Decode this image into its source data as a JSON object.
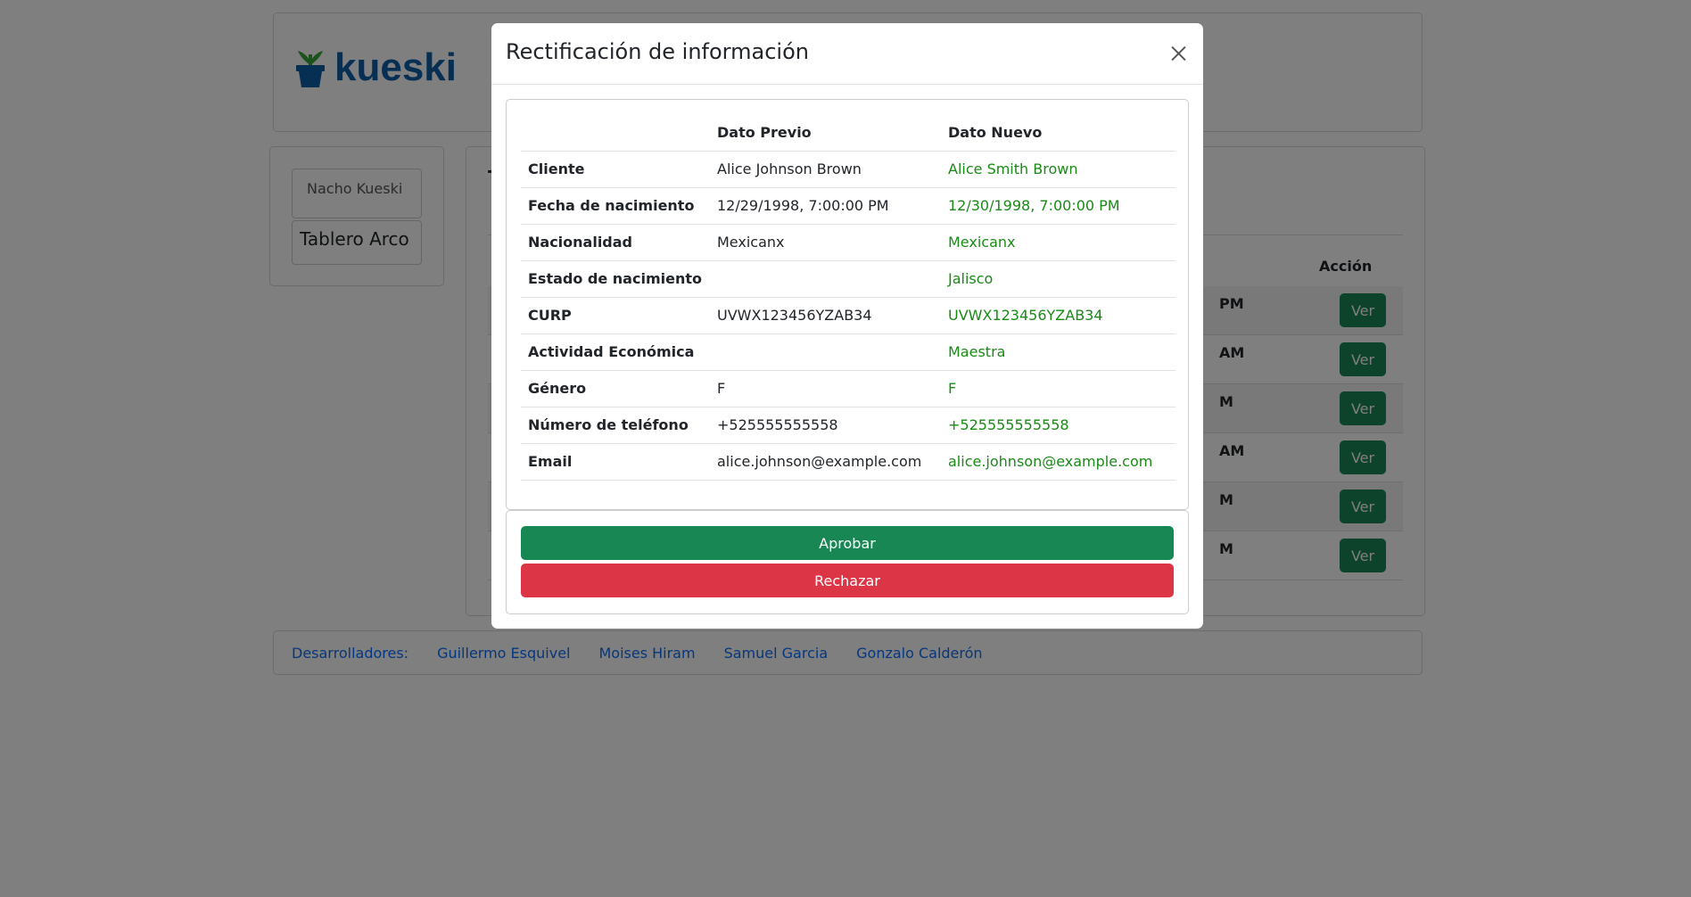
{
  "header": {
    "logo_text": "kueski"
  },
  "sidebar": {
    "user_label": "Nacho Kueski",
    "board_label": "Tablero Arco"
  },
  "main": {
    "title_partial": "T",
    "link_partial": "s",
    "action_header": "Acción",
    "rows": [
      {
        "time_partial": "PM",
        "button_label": "Ver"
      },
      {
        "time_partial": "AM",
        "button_label": "Ver"
      },
      {
        "time_partial": "M",
        "button_label": "Ver"
      },
      {
        "time_partial": "AM",
        "button_label": "Ver"
      },
      {
        "time_partial": "M",
        "button_label": "Ver"
      },
      {
        "time_partial": "M",
        "button_label": "Ver"
      }
    ]
  },
  "footer": {
    "label": "Desarrolladores:",
    "developers": [
      "Guillermo Esquivel",
      "Moises Hiram",
      "Samuel Garcia",
      "Gonzalo Calderón"
    ]
  },
  "modal": {
    "title": "Rectificación de información",
    "columns": {
      "field": "",
      "previous": "Dato Previo",
      "new": "Dato Nuevo"
    },
    "rows": [
      {
        "label": "Cliente",
        "previous": "Alice Johnson Brown",
        "new": "Alice Smith Brown"
      },
      {
        "label": "Fecha de nacimiento",
        "previous": "12/29/1998, 7:00:00 PM",
        "new": "12/30/1998, 7:00:00 PM"
      },
      {
        "label": "Nacionalidad",
        "previous": "Mexicanx",
        "new": "Mexicanx"
      },
      {
        "label": "Estado de nacimiento",
        "previous": "",
        "new": "Jalisco"
      },
      {
        "label": "CURP",
        "previous": "UVWX123456YZAB34",
        "new": "UVWX123456YZAB34"
      },
      {
        "label": "Actividad Económica",
        "previous": "",
        "new": "Maestra"
      },
      {
        "label": "Género",
        "previous": "F",
        "new": "F"
      },
      {
        "label": "Número de teléfono",
        "previous": "+525555555558",
        "new": "+525555555558"
      },
      {
        "label": "Email",
        "previous": "alice.johnson@example.com",
        "new": "alice.johnson@example.com"
      }
    ],
    "approve_label": "Aprobar",
    "reject_label": "Rechazar"
  },
  "colors": {
    "brand_blue": "#0d5fa6",
    "brand_green": "#2e9b2e",
    "approve_green": "#198754",
    "reject_red": "#dc3545",
    "new_value_green": "#1a8a16"
  },
  "icons": {
    "close": "close-icon",
    "logo": "plant-pot-logo-icon"
  }
}
